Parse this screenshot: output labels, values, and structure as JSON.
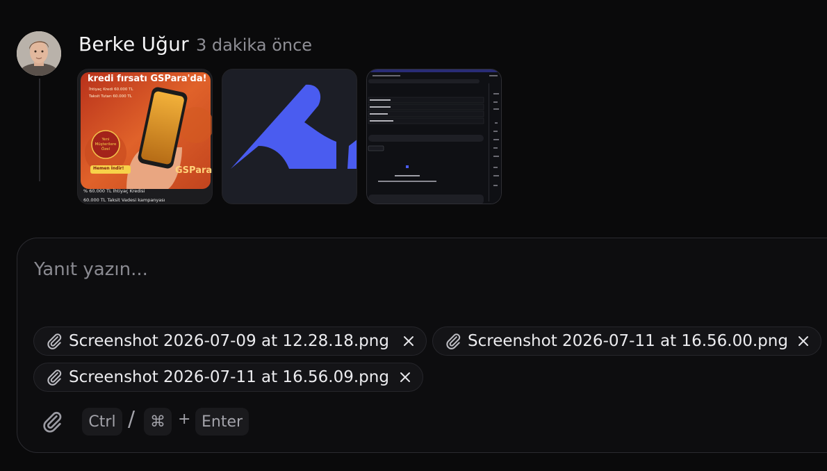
{
  "comment": {
    "author": "Berke Uğur",
    "time": "3 dakika önce",
    "avatar_icon": "user-avatar",
    "attachments": [
      {
        "kind": "image",
        "headline": "kredi fırsatı GSPara'da!",
        "line1": "İhtiyaç Kredi 60.000 TL",
        "line2": "Taksit Tutarı 60.000 TL",
        "badge": "Yeni Müşterilere Özel",
        "cta": "Hemen İndir!",
        "brand": "GSPara",
        "caption1": "% 60.000 TL İhtiyaç Kredisi",
        "caption2": "60.000 TL Taksit Vadesi kampanyası"
      },
      {
        "kind": "image",
        "icon": "blue-logo"
      },
      {
        "kind": "image",
        "icon": "screenshot-preview"
      }
    ]
  },
  "reply": {
    "placeholder": "Yanıt yazın...",
    "files": [
      {
        "name": "Screenshot 2026-07-09 at 12.28.18.png"
      },
      {
        "name": "Screenshot 2026-07-11 at 16.56.00.png"
      },
      {
        "name": "Screenshot 2026-07-11 at 16.56.09.png"
      }
    ],
    "shortcut": {
      "ctrl": "Ctrl",
      "slash": "/",
      "cmd": "⌘",
      "plus": "+",
      "enter": "Enter"
    }
  },
  "colors": {
    "background": "#0a0a0b",
    "accent_blue": "#4a5cf0",
    "promo_orange": "#e0622a"
  }
}
